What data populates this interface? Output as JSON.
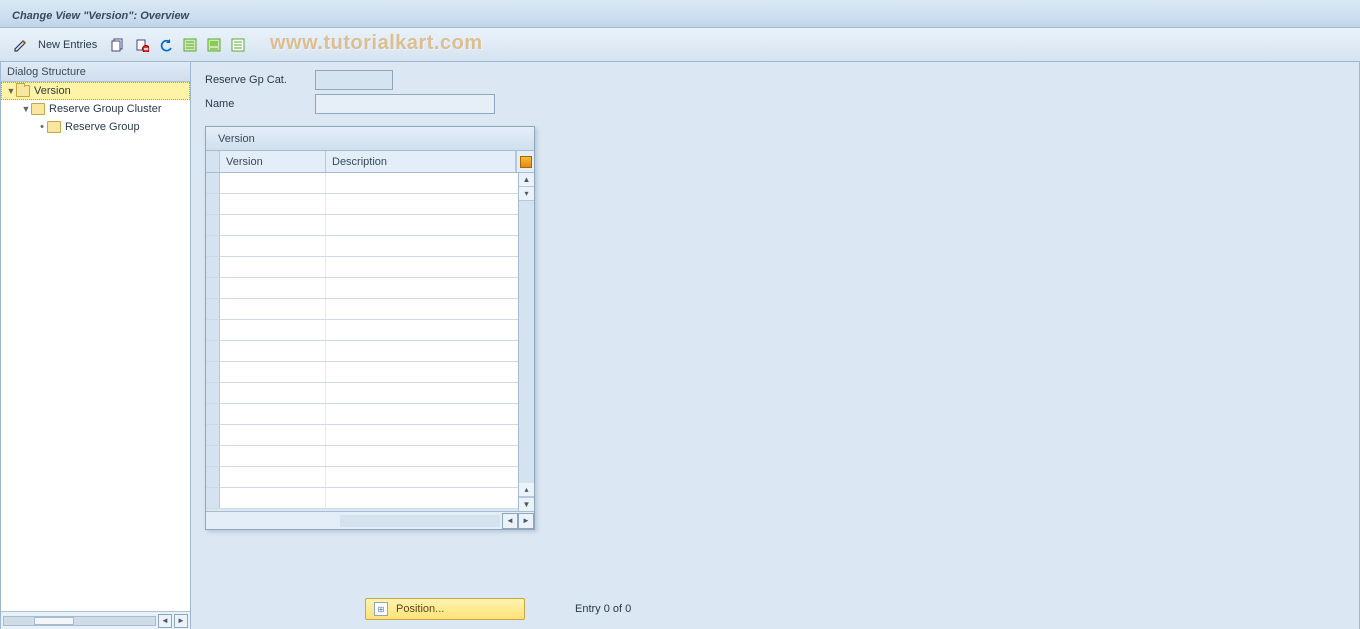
{
  "title": "Change View \"Version\": Overview",
  "watermark": "www.tutorialkart.com",
  "toolbar": {
    "new_entries_label": "New Entries"
  },
  "sidebar": {
    "header": "Dialog Structure",
    "items": [
      {
        "label": "Version",
        "level": 0,
        "open": true,
        "selected": true
      },
      {
        "label": "Reserve Group Cluster",
        "level": 1,
        "open": false,
        "selected": false
      },
      {
        "label": "Reserve Group",
        "level": 2,
        "open": false,
        "selected": false
      }
    ]
  },
  "fields": {
    "reserve_gp_cat_label": "Reserve Gp Cat.",
    "reserve_gp_cat_value": "",
    "name_label": "Name",
    "name_value": ""
  },
  "table": {
    "title": "Version",
    "columns": {
      "c1": "Version",
      "c2": "Description"
    },
    "row_count": 16
  },
  "footer": {
    "position_label": "Position...",
    "entry_text": "Entry 0 of 0"
  }
}
